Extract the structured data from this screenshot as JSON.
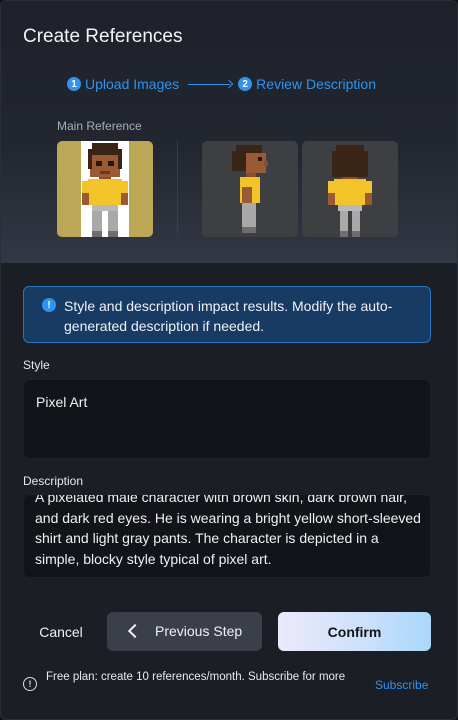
{
  "dialog": {
    "title": "Create References"
  },
  "stepper": {
    "steps": [
      {
        "number": "1",
        "label": "Upload Images"
      },
      {
        "number": "2",
        "label": "Review Description"
      }
    ]
  },
  "references": {
    "main_label": "Main Reference",
    "images": [
      "main-reference-front",
      "side-view",
      "back-view"
    ]
  },
  "info_banner": {
    "icon": "info-icon",
    "text": "Style and description impact results. Modify the auto-generated description if needed."
  },
  "style_field": {
    "label": "Style",
    "value": "Pixel Art"
  },
  "description_field": {
    "label": "Description",
    "value": "A pixelated male character with brown skin, dark brown hair, and dark red eyes. He is wearing a bright yellow short-sleeved shirt and light gray pants. The character is depicted in a simple, blocky style typical of pixel art."
  },
  "actions": {
    "cancel_label": "Cancel",
    "previous_label": "Previous Step",
    "confirm_label": "Confirm"
  },
  "footer": {
    "plan_text": "Free plan: create 10 references/month. Subscribe for more",
    "subscribe_label": "Subscribe"
  },
  "colors": {
    "accent": "#2f93f0",
    "banner_bg": "#173b62",
    "dialog_bg": "#1b1e25"
  }
}
